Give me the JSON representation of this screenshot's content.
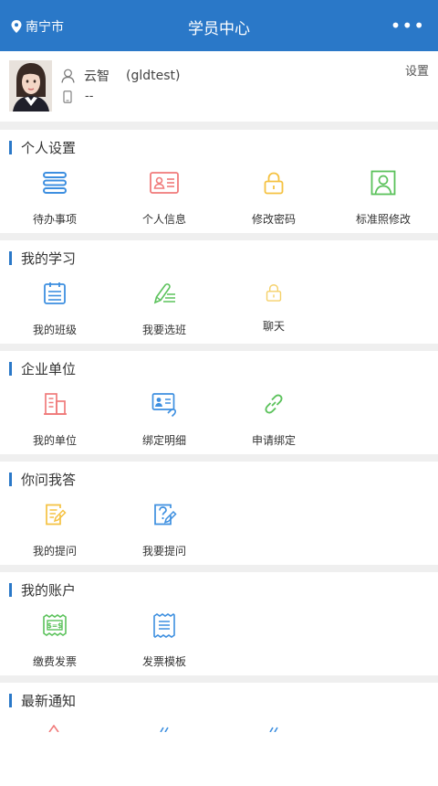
{
  "header": {
    "city": "南宁市",
    "title": "学员中心",
    "more": "•••"
  },
  "profile": {
    "name": "云智",
    "username": "(gldtest)",
    "phone": "--",
    "settings": "设置"
  },
  "sections": [
    {
      "title": "个人设置",
      "items": [
        "待办事项",
        "个人信息",
        "修改密码",
        "标准照修改"
      ]
    },
    {
      "title": "我的学习",
      "items": [
        "我的班级",
        "我要选班",
        "聊天"
      ]
    },
    {
      "title": "企业单位",
      "items": [
        "我的单位",
        "绑定明细",
        "申请绑定"
      ]
    },
    {
      "title": "你问我答",
      "items": [
        "我的提问",
        "我要提问"
      ]
    },
    {
      "title": "我的账户",
      "items": [
        "缴费发票",
        "发票模板"
      ]
    },
    {
      "title": "最新通知",
      "items": []
    }
  ],
  "colors": {
    "brand": "#2a78c8",
    "blue_icon": "#3d8fe0",
    "red_icon": "#f07a7a",
    "yellow_icon": "#f5c242",
    "green_icon": "#5bc25b"
  }
}
